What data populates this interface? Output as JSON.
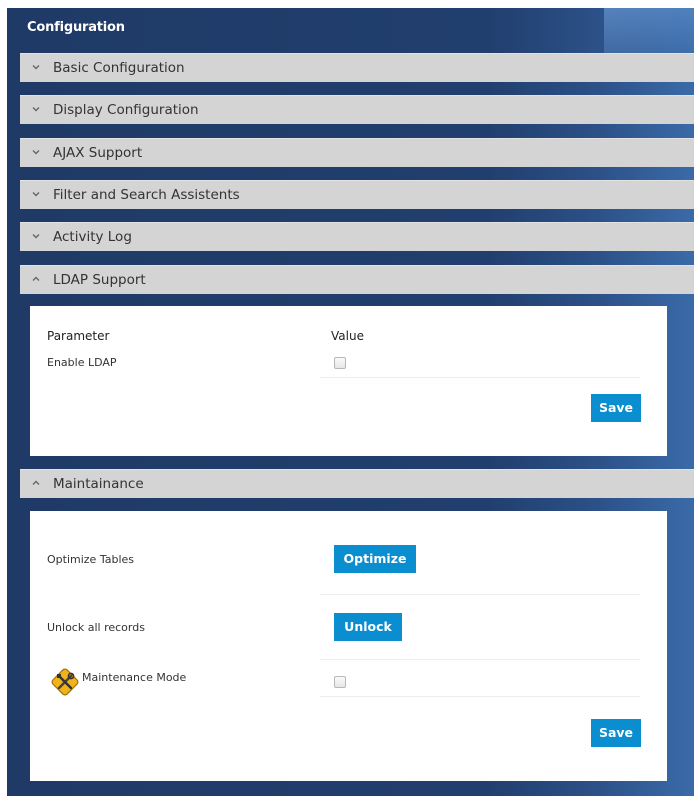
{
  "panel": {
    "title": "Configuration"
  },
  "sections": [
    {
      "label": "Basic Configuration",
      "state": "collapsed"
    },
    {
      "label": "Display Configuration",
      "state": "collapsed"
    },
    {
      "label": "AJAX Support",
      "state": "collapsed"
    },
    {
      "label": "Filter and Search Assistents",
      "state": "collapsed"
    },
    {
      "label": "Activity Log",
      "state": "collapsed"
    },
    {
      "label": "LDAP Support",
      "state": "expanded"
    },
    {
      "label": "Maintainance",
      "state": "expanded"
    }
  ],
  "ldap": {
    "param_header": "Parameter",
    "value_header": "Value",
    "enable_label": "Enable LDAP",
    "enable_checked": false,
    "save_label": "Save"
  },
  "maintenance": {
    "optimize_label": "Optimize Tables",
    "optimize_button": "Optimize",
    "unlock_label": "Unlock all records",
    "unlock_button": "Unlock",
    "mode_label": "Maintenance Mode",
    "mode_icon": "tools-icon",
    "mode_checked": false,
    "save_label": "Save"
  },
  "colors": {
    "panel_bg": "#213f6e",
    "header_bg": "#d4d4d4",
    "button": "#0a8ed0"
  }
}
